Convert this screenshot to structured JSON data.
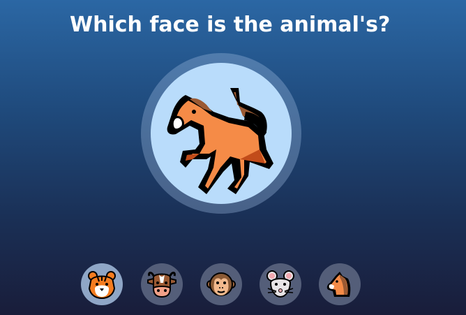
{
  "prompt": {
    "question": "Which face is the animal's?"
  },
  "target": {
    "animal": "horse",
    "icon": "horse-icon"
  },
  "choices": [
    {
      "animal": "tiger",
      "icon": "tiger-face-icon",
      "selected": true
    },
    {
      "animal": "cow",
      "icon": "cow-face-icon",
      "selected": false
    },
    {
      "animal": "monkey",
      "icon": "monkey-face-icon",
      "selected": false
    },
    {
      "animal": "mouse",
      "icon": "mouse-face-icon",
      "selected": false
    },
    {
      "animal": "horse",
      "icon": "horse-face-icon",
      "selected": false
    }
  ],
  "colors": {
    "background_top": "#2b67a4",
    "background_bottom": "#191d3a",
    "disc": "#b9dcfb",
    "choice_bg": "#545e79",
    "choice_selected_bg": "#8fa6c6"
  }
}
